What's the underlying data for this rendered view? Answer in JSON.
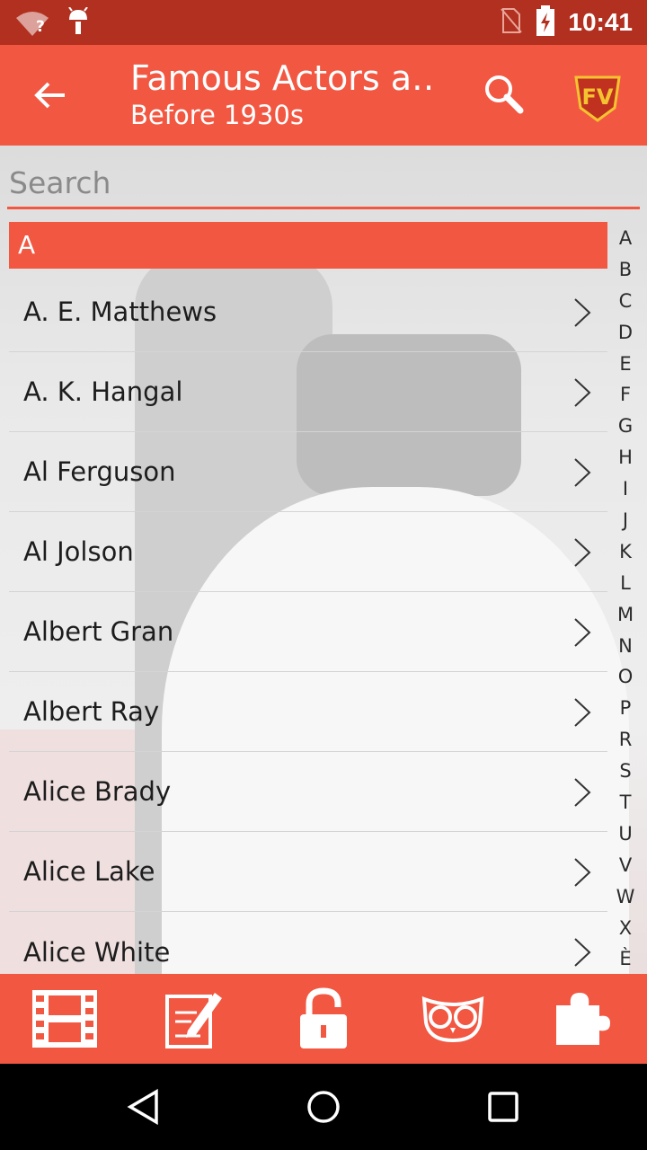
{
  "status_bar": {
    "time": "10:41",
    "wifi_unknown_glyph": "?"
  },
  "app_bar": {
    "title": "Famous Actors a…",
    "subtitle": "Before 1930s",
    "back_icon": "arrow-left-icon",
    "search_icon": "magnifier-icon",
    "logo_text": "FV"
  },
  "search": {
    "placeholder": "Search"
  },
  "list": {
    "section": "A",
    "items": [
      "A. E. Matthews",
      "A. K. Hangal",
      "Al Ferguson",
      "Al Jolson",
      "Albert Gran",
      "Albert Ray",
      "Alice Brady",
      "Alice Lake",
      "Alice White"
    ]
  },
  "index_letters": [
    "A",
    "B",
    "C",
    "D",
    "E",
    "F",
    "G",
    "H",
    "I",
    "J",
    "K",
    "L",
    "M",
    "N",
    "O",
    "P",
    "R",
    "S",
    "T",
    "U",
    "V",
    "W",
    "X",
    "È"
  ],
  "toolbar": [
    "film-icon",
    "edit-icon",
    "unlock-icon",
    "owl-icon",
    "puzzle-icon"
  ],
  "navbar": [
    "back-triangle-icon",
    "home-circle-icon",
    "recents-square-icon"
  ],
  "colors": {
    "accent": "#f25742",
    "status": "#b2301f"
  }
}
